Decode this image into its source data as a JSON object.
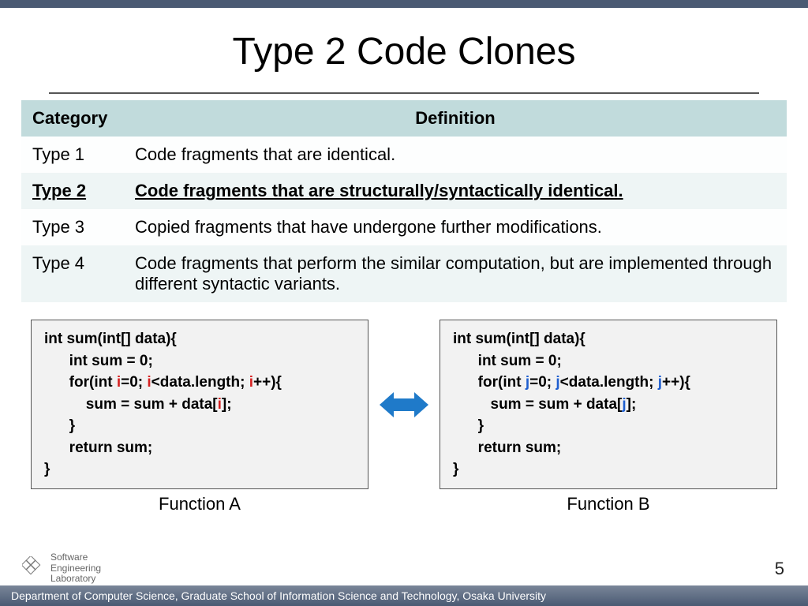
{
  "title": "Type 2 Code Clones",
  "table": {
    "headers": {
      "category": "Category",
      "definition": "Definition"
    },
    "rows": [
      {
        "label": "Type 1",
        "def": "Code fragments that are identical.",
        "emphasis": false
      },
      {
        "label": "Type 2",
        "def": "Code fragments that are structurally/syntactically identical.",
        "emphasis": true
      },
      {
        "label": "Type 3",
        "def": "Copied fragments that have undergone further modifications.",
        "emphasis": false
      },
      {
        "label": "Type 4",
        "def": "Code fragments that perform the similar computation, but are implemented through different syntactic variants.",
        "emphasis": false
      }
    ]
  },
  "code": {
    "functionA": {
      "label": "Function A",
      "lines": {
        "l1": "int sum(int[] data){",
        "l2": "      int sum = 0;",
        "l3a": "      for(int ",
        "l3b": "=0; ",
        "l3c": "<data.length; ",
        "l3d": "++){",
        "l4a": "          sum = sum + data[",
        "l4b": "];",
        "l5": "      }",
        "l6": "      return sum;",
        "l7": "}"
      },
      "var": "i",
      "varClass": "red"
    },
    "functionB": {
      "label": "Function B",
      "lines": {
        "l1": "int sum(int[] data){",
        "l2": "      int sum = 0;",
        "l3a": "      for(int ",
        "l3b": "=0; ",
        "l3c": "<data.length; ",
        "l3d": "++){",
        "l4a": "         sum = sum + data[",
        "l4b": "];",
        "l5": "      }",
        "l6": "      return sum;",
        "l7": "}"
      },
      "var": "j",
      "varClass": "blue"
    }
  },
  "footer": {
    "labName": "Software\nEngineering\nLaboratory",
    "dept": "Department of Computer Science, Graduate School of Information Science and Technology, Osaka University",
    "slideNumber": "5"
  }
}
